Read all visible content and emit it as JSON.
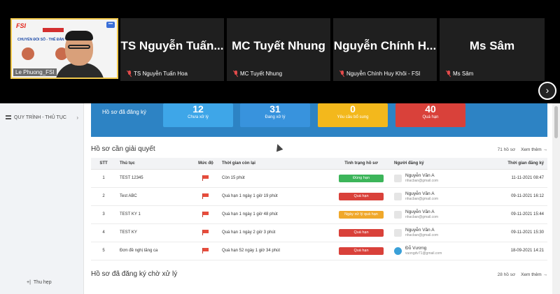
{
  "meeting": {
    "self_label": "Le Phuong_FSI",
    "slide_logo": "FSI",
    "slide_text": "CHUYỂN ĐỔI SỐ - THẾ ĐÀN",
    "participants": [
      {
        "display": "TS Nguyễn Tuấn...",
        "caption": "TS Nguyễn Tuấn Hoa"
      },
      {
        "display": "MC Tuyết Nhung",
        "caption": "MC Tuyết Nhung"
      },
      {
        "display": "Nguyễn Chính H...",
        "caption": "Nguyễn Chính Huy Khôi - FSI"
      },
      {
        "display": "Ms Sâm",
        "caption": "Ms Sâm"
      }
    ],
    "next_icon": "›"
  },
  "sidebar": {
    "item_label": "QUY TRÌNH - THỦ TỤC",
    "chevron": "›",
    "collapse_label": "Thu hẹp",
    "collapse_icon": "+|"
  },
  "stats": {
    "title": "Hồ sơ đã đăng ký",
    "cards": [
      {
        "num": "12",
        "label": "Chưa xử lý",
        "color": "#3ea6e8"
      },
      {
        "num": "31",
        "label": "Đang xử lý",
        "color": "#3893dd"
      },
      {
        "num": "0",
        "label": "Yêu cầu bổ sung",
        "color": "#f3b81c"
      },
      {
        "num": "40",
        "label": "Quá hạn",
        "color": "#d9413a"
      }
    ]
  },
  "section1": {
    "title": "Hồ sơ cần giải quyết",
    "count": "71 hồ sơ",
    "more": "Xem thêm →"
  },
  "table": {
    "headers": [
      "STT",
      "Thủ tục",
      "Mức độ",
      "Thời gian còn lại",
      "Tình trạng hồ sơ",
      "Người đăng ký",
      "Thời gian đăng ký"
    ],
    "rows": [
      {
        "stt": "1",
        "proc": "TEST 12345",
        "remain": "Còn 15 phút",
        "status": "Đúng hạn",
        "status_color": "#3cb55a",
        "user": "Nguyễn Văn A",
        "email": "nhacban@gmail.com",
        "date": "11-11-2021 08:47"
      },
      {
        "stt": "2",
        "proc": "Test ABC",
        "remain": "Quá hạn 1 ngày 1 giờ 19 phút",
        "status": "Quá hạn",
        "status_color": "#d9413a",
        "user": "Nguyễn Văn A",
        "email": "nhacban@gmail.com",
        "date": "09-11-2021 16:12"
      },
      {
        "stt": "3",
        "proc": "TEST KY 1",
        "remain": "Quá hạn 1 ngày 1 giờ 48 phút",
        "status": "Ngày xử lý quá hạn",
        "status_color": "#f0a82a",
        "user": "Nguyễn Văn A",
        "email": "nhacban@gmail.com",
        "date": "09-11-2021 15:44"
      },
      {
        "stt": "4",
        "proc": "TEST KY",
        "remain": "Quá hạn 1 ngày 2 giờ 3 phút",
        "status": "Quá hạn",
        "status_color": "#d9413a",
        "user": "Nguyễn Văn A",
        "email": "nhacban@gmail.com",
        "date": "09-11-2021 15:30"
      },
      {
        "stt": "5",
        "proc": "Đơn đề nghị tăng ca",
        "remain": "Quá hạn 52 ngày 1 giờ 34 phút",
        "status": "Quá hạn",
        "status_color": "#d9413a",
        "user": "Đỗ Vương",
        "email": "vuongdv71@gmail.com",
        "date": "18-09-2021 14:21"
      }
    ]
  },
  "section2": {
    "title": "Hồ sơ đã đăng ký chờ xử lý",
    "count": "28 hồ sơ",
    "more": "Xem thêm →"
  }
}
